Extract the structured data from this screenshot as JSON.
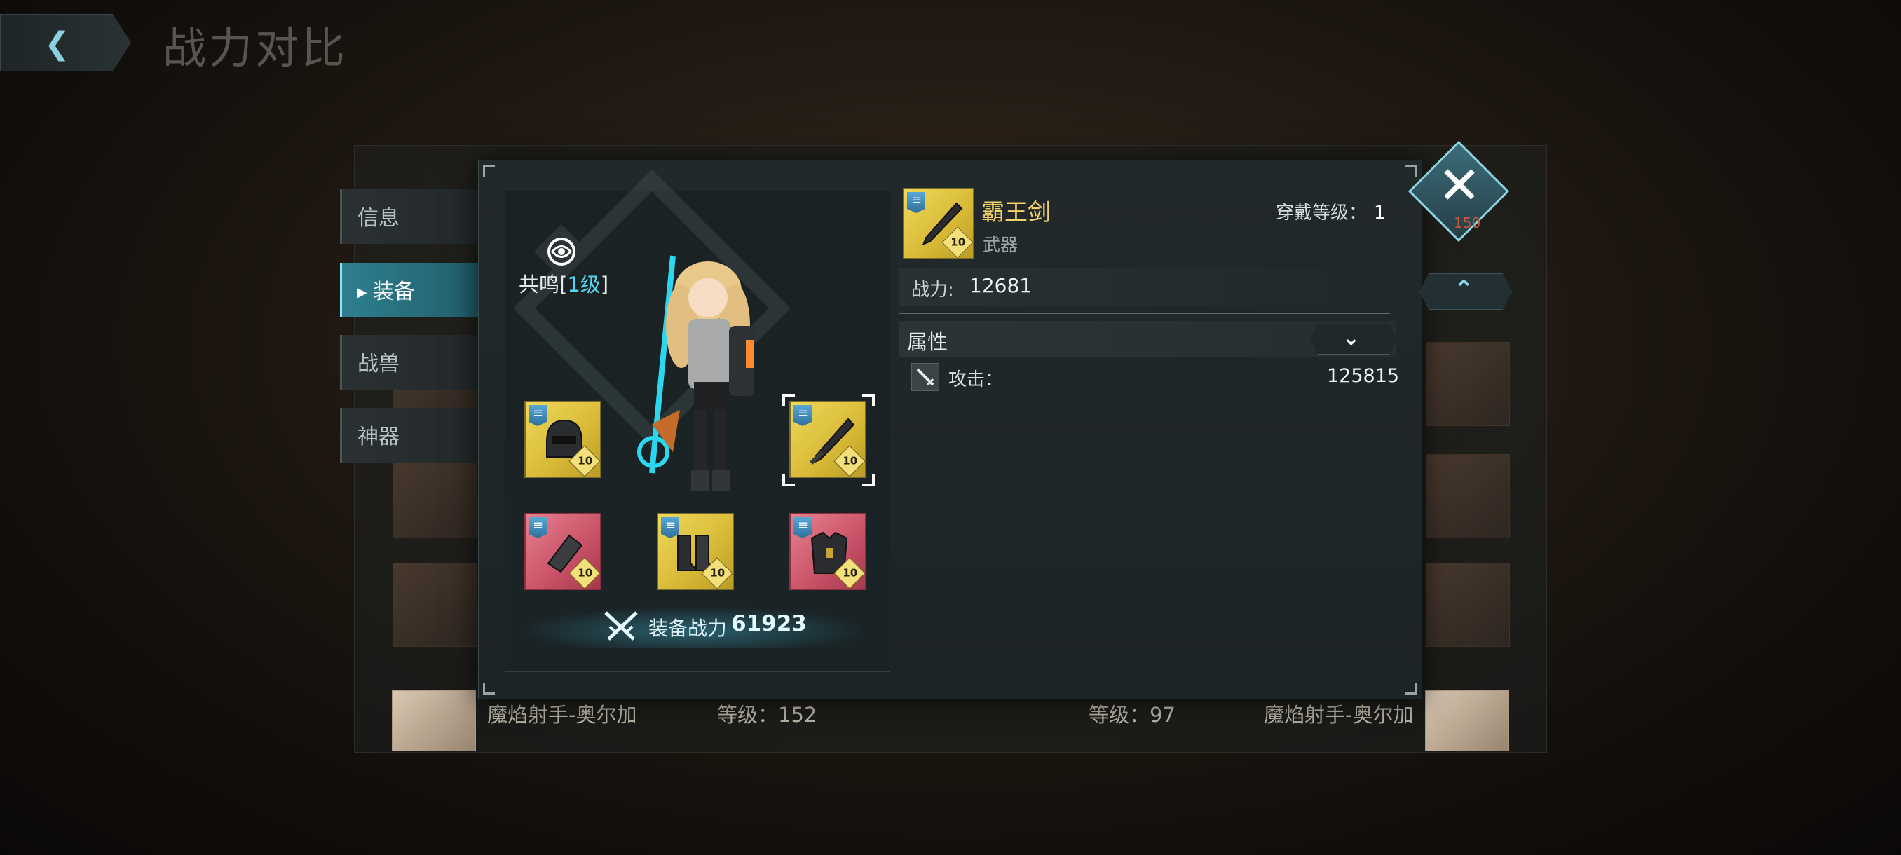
{
  "header": {
    "title": "战力对比"
  },
  "tabs": [
    "信息",
    "装备",
    "战兽",
    "神器"
  ],
  "active_tab": "装备",
  "background_table": {
    "last_row": {
      "left_name": "魔焰射手-奥尔加",
      "left_level": "等级：152",
      "right_level": "等级：97",
      "right_name": "魔焰射手-奥尔加"
    },
    "badge_number": "150"
  },
  "character_panel": {
    "resonance": {
      "label": "共鸣",
      "bracket_open": "[",
      "level": "1级",
      "bracket_close": "]"
    },
    "equipment_slots": [
      {
        "slot": "helmet",
        "rarity": "gold",
        "level": "10"
      },
      {
        "slot": "weapon",
        "rarity": "gold",
        "level": "10",
        "selected": true
      },
      {
        "slot": "gauntlet",
        "rarity": "red",
        "level": "10"
      },
      {
        "slot": "boots",
        "rarity": "gold",
        "level": "10"
      },
      {
        "slot": "armor",
        "rarity": "red",
        "level": "10"
      }
    ],
    "equip_power_label": "装备战力",
    "equip_power_value": "61923"
  },
  "item_detail": {
    "name": "霸王剑",
    "type": "武器",
    "wear_level_label": "穿戴等级：",
    "wear_level_value": "1",
    "power_label": "战力:",
    "power_value": "12681",
    "attributes_label": "属性",
    "attributes": [
      {
        "icon": "sword-icon",
        "label": "攻击：",
        "value": "125815"
      }
    ]
  },
  "colors": {
    "accent_cyan": "#53d9f2",
    "gold_name": "#f2d26a",
    "gold_slot": "#d7b936",
    "red_slot": "#c85166"
  }
}
